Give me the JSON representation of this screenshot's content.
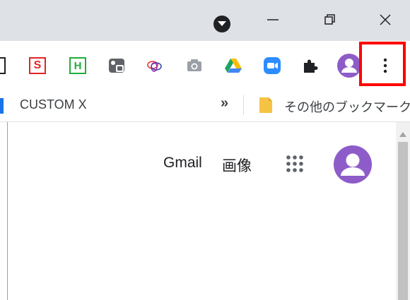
{
  "titlebar": {
    "window_controls": [
      "minimize",
      "restore",
      "close"
    ]
  },
  "toolbar": {
    "extensions": [
      {
        "name": "s-extension",
        "label": "S",
        "color": "#e32222"
      },
      {
        "name": "h-extension",
        "label": "H",
        "color": "#1fae3a"
      },
      {
        "name": "cast-extension"
      },
      {
        "name": "rings-extension"
      },
      {
        "name": "camera-extension"
      },
      {
        "name": "google-drive-extension"
      },
      {
        "name": "zoom-extension",
        "color": "#2d8cff"
      },
      {
        "name": "extensions-puzzle"
      }
    ],
    "avatar_color": "#8e5cc8",
    "menu_highlight_color": "#ff0000"
  },
  "bookmarks": {
    "custom_label": "CUSTOM X",
    "overflow_label": "»",
    "other_bookmarks_label": "その他のブックマーク",
    "folder_color": "#f6c344"
  },
  "google_bar": {
    "gmail_label": "Gmail",
    "images_label": "画像"
  }
}
